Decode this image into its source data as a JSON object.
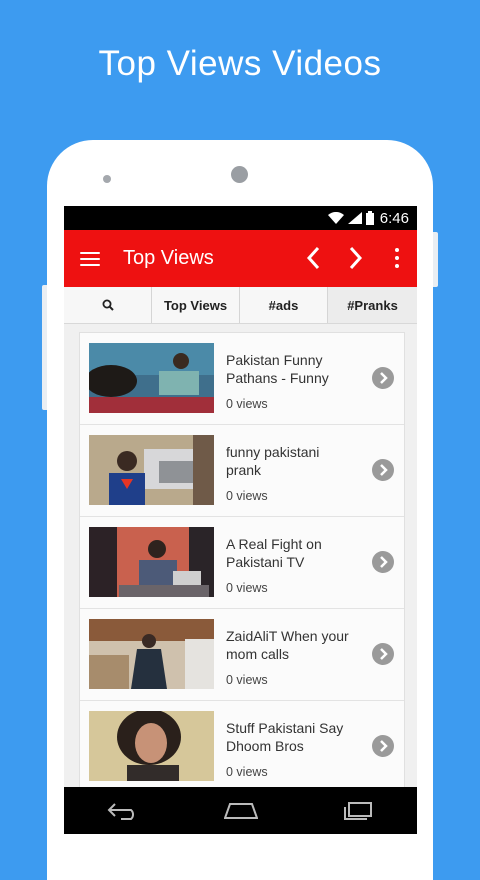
{
  "promo": {
    "title": "Top Views Videos"
  },
  "status_bar": {
    "time": "6:46",
    "icons": [
      "wifi-icon",
      "signal-icon",
      "battery-icon"
    ]
  },
  "app_bar": {
    "title": "Top Views",
    "icons": [
      "menu-icon",
      "chevron-left-icon",
      "chevron-right-icon",
      "overflow-menu-icon"
    ]
  },
  "tabs": [
    {
      "label": "",
      "icon": "search-icon"
    },
    {
      "label": "Top Views"
    },
    {
      "label": "#ads"
    },
    {
      "label": "#Pranks"
    }
  ],
  "videos": [
    {
      "title": "Pakistan Funny Pathans - Funny",
      "views": "0 views"
    },
    {
      "title": "funny pakistani prank",
      "views": "0 views"
    },
    {
      "title": "A Real Fight on Pakistani TV",
      "views": "0 views"
    },
    {
      "title": "ZaidAliT When your mom calls",
      "views": "0 views"
    },
    {
      "title": "Stuff Pakistani Say Dhoom Bros",
      "views": "0 views"
    }
  ],
  "nav_bar": {
    "icons": [
      "back-icon",
      "home-icon",
      "recents-icon"
    ]
  },
  "colors": {
    "background": "#3d9bf0",
    "app_bar": "#ee1111",
    "arrow": "#9a9a9a"
  }
}
